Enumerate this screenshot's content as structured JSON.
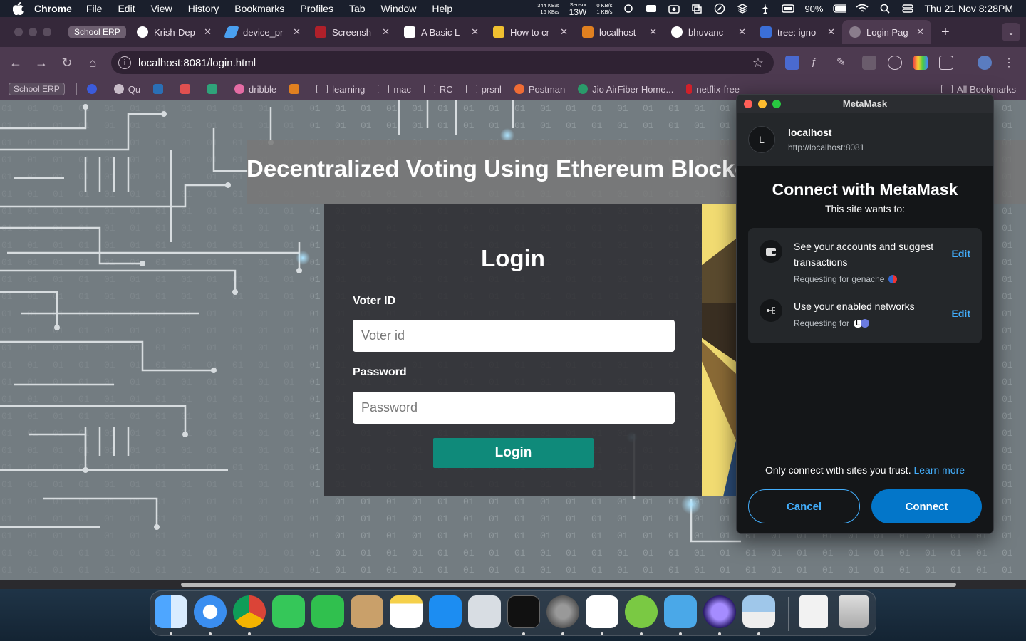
{
  "menubar": {
    "app": "Chrome",
    "items": [
      "File",
      "Edit",
      "View",
      "History",
      "Bookmarks",
      "Profiles",
      "Tab",
      "Window",
      "Help"
    ],
    "net_up": "344 KB/s",
    "net_down": "16 KB/s",
    "sensor_label": "Sensor",
    "sensor_value": "13W",
    "disk_read": "0 KB/s",
    "disk_write": "1 KB/s",
    "battery": "90%",
    "datetime": "Thu 21 Nov  8:28PM"
  },
  "tabs": {
    "pinned": "School ERP",
    "items": [
      {
        "title": "Krish-Dep",
        "color": "#222222"
      },
      {
        "title": "device_pr",
        "color": "#4aa0f0"
      },
      {
        "title": "Screensh",
        "color": "#b0202a"
      },
      {
        "title": "A Basic L",
        "color": "#000000"
      },
      {
        "title": "How to cr",
        "color": "#f0c030"
      },
      {
        "title": "localhost",
        "color": "#e08020"
      },
      {
        "title": "bhuvanc",
        "color": "#222222"
      },
      {
        "title": "tree: igno",
        "color": "#3b6fd8"
      },
      {
        "title": "Login Pag",
        "color": "#8a7d8c"
      }
    ]
  },
  "address": {
    "url": "localhost:8081/login.html"
  },
  "bookmarks": {
    "erp": "School ERP",
    "items": [
      {
        "label": "Qu",
        "kind": "quora"
      },
      {
        "label": "dribble",
        "kind": "dribbble"
      },
      {
        "label": "learning",
        "kind": "folder"
      },
      {
        "label": "mac",
        "kind": "folder"
      },
      {
        "label": "RC",
        "kind": "folder"
      },
      {
        "label": "prsnl",
        "kind": "folder"
      },
      {
        "label": "Postman",
        "kind": "postman"
      },
      {
        "label": "Jio AirFiber Home...",
        "kind": "jio"
      },
      {
        "label": "netflix-free",
        "kind": "netflix"
      }
    ],
    "all": "All Bookmarks"
  },
  "page": {
    "title": "Decentralized Voting Using Ethereum Blockchain",
    "login_heading": "Login",
    "voter_label": "Voter ID",
    "voter_placeholder": "Voter id",
    "password_label": "Password",
    "password_placeholder": "Password",
    "login_button": "Login"
  },
  "metamask": {
    "window_title": "MetaMask",
    "avatar": "L",
    "site": "localhost",
    "site_url": "http://localhost:8081",
    "heading": "Connect with MetaMask",
    "subheading": "This site wants to:",
    "perm1_text": "See your accounts and suggest transactions",
    "perm1_sub": "Requesting for genache",
    "perm1_edit": "Edit",
    "perm2_text": "Use your enabled networks",
    "perm2_sub": "Requesting for",
    "perm2_badge": "L",
    "perm2_edit": "Edit",
    "trust_text": "Only connect with sites you trust.",
    "learn_more": "Learn more",
    "cancel": "Cancel",
    "connect": "Connect"
  },
  "dock": {
    "apps": [
      "finder-icon",
      "safari-icon",
      "chrome-icon",
      "messages-icon",
      "facetime-icon",
      "contacts-icon",
      "notes-icon",
      "app-store-icon",
      "launchpad-icon",
      "terminal-icon",
      "system-settings-icon",
      "vscode-icon",
      "bruno-icon",
      "migrate-icon",
      "proton-icon",
      "preview-icon",
      "document-icon",
      "trash-icon"
    ]
  },
  "colors": {
    "chrome_frame": "#4d3a50",
    "accent_teal": "#0f8a7a",
    "metamask_blue": "#0376c9",
    "metamask_link": "#43aefc"
  }
}
